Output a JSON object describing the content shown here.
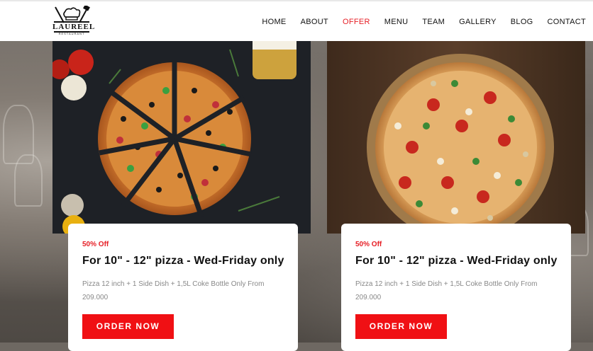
{
  "brand": {
    "name": "LAUREEL",
    "subtitle": "RESTAURANT"
  },
  "nav": {
    "items": [
      "HOME",
      "ABOUT",
      "OFFER",
      "MENU",
      "TEAM",
      "GALLERY",
      "BLOG",
      "CONTACT"
    ],
    "active": "OFFER"
  },
  "offers": [
    {
      "badge": "50% Off",
      "title": "For 10\" - 12\" pizza - Wed-Friday only",
      "description": "Pizza 12 inch + 1 Side Dish + 1,5L Coke Bottle Only From 209.000",
      "button": "ORDER NOW"
    },
    {
      "badge": "50% Off",
      "title": "For 10\" - 12\" pizza - Wed-Friday only",
      "description": "Pizza 12 inch + 1 Side Dish + 1,5L Coke Bottle Only From 209.000",
      "button": "ORDER NOW"
    }
  ],
  "colors": {
    "accent": "#e61e25",
    "button": "#f01014"
  }
}
